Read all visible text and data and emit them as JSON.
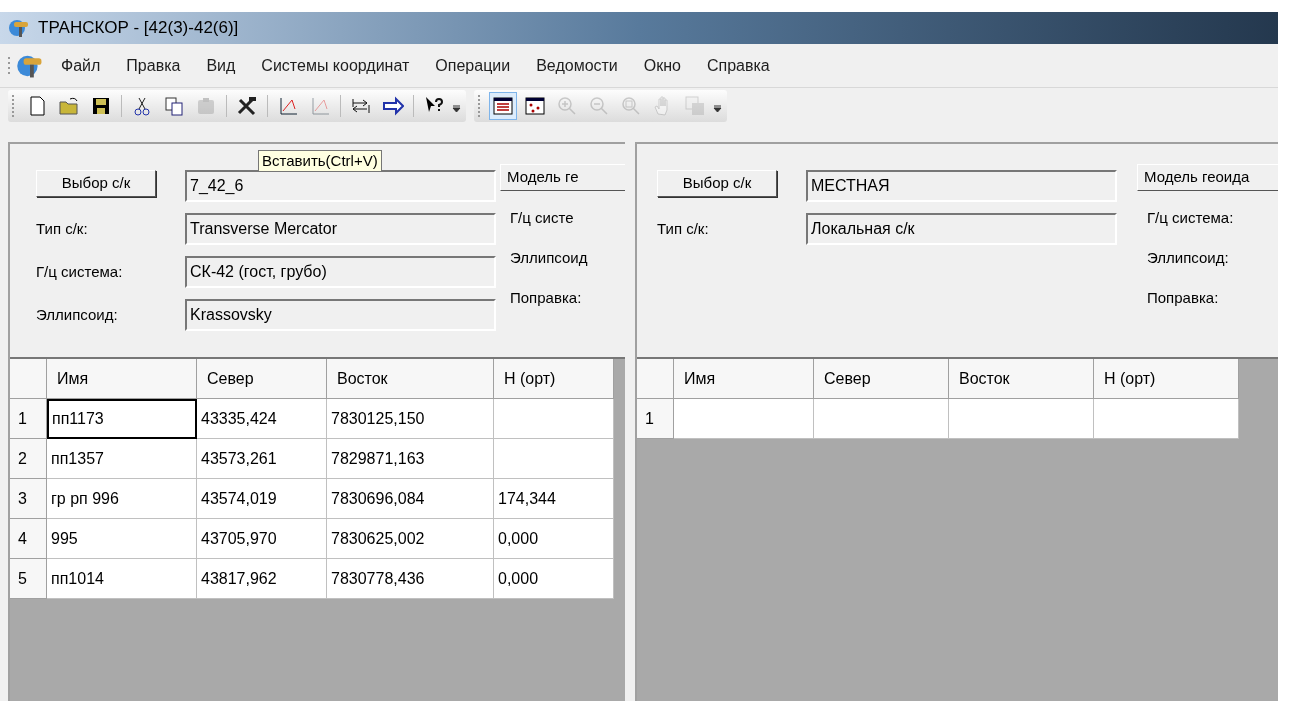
{
  "window": {
    "title": "ТРАНСКОР - [42(3)-42(6)]"
  },
  "menu": [
    "Файл",
    "Правка",
    "Вид",
    "Системы координат",
    "Операции",
    "Ведомости",
    "Окно",
    "Справка"
  ],
  "toolbars": [
    [
      {
        "kind": "new",
        "disabled": false,
        "selected": false,
        "group_end": false
      },
      {
        "kind": "open",
        "disabled": false,
        "selected": false,
        "group_end": false
      },
      {
        "kind": "save",
        "disabled": false,
        "selected": false,
        "group_end": true
      },
      {
        "kind": "cut",
        "disabled": false,
        "selected": false,
        "group_end": false
      },
      {
        "kind": "copy",
        "disabled": false,
        "selected": false,
        "group_end": false
      },
      {
        "kind": "paste",
        "disabled": true,
        "selected": false,
        "group_end": true
      },
      {
        "kind": "tools",
        "disabled": false,
        "selected": false,
        "group_end": true
      },
      {
        "kind": "axes",
        "disabled": false,
        "selected": false,
        "group_end": false
      },
      {
        "kind": "axes",
        "disabled": true,
        "selected": false,
        "group_end": true
      },
      {
        "kind": "swap",
        "disabled": false,
        "selected": false,
        "group_end": false
      },
      {
        "kind": "arrow",
        "disabled": false,
        "selected": false,
        "group_end": true
      },
      {
        "kind": "help",
        "disabled": false,
        "selected": false,
        "group_end": false
      }
    ],
    [
      {
        "kind": "list",
        "disabled": false,
        "selected": true,
        "group_end": false
      },
      {
        "kind": "map",
        "disabled": false,
        "selected": false,
        "group_end": false
      },
      {
        "kind": "zoomin",
        "disabled": true,
        "selected": false,
        "group_end": false
      },
      {
        "kind": "zoomout",
        "disabled": true,
        "selected": false,
        "group_end": false
      },
      {
        "kind": "zoomfit",
        "disabled": true,
        "selected": false,
        "group_end": false
      },
      {
        "kind": "hand",
        "disabled": true,
        "selected": false,
        "group_end": false
      },
      {
        "kind": "layer",
        "disabled": true,
        "selected": false,
        "group_end": false
      }
    ]
  ],
  "tooltip": "Вставить(Ctrl+V)",
  "panels": [
    {
      "select_button": "Выбор с/к",
      "name_value": "7_42_6",
      "model_button": "Модель ге",
      "fields": [
        {
          "label": "Тип с/к:",
          "value": "Transverse Mercator"
        },
        {
          "label": "Г/ц система:",
          "value": "СК-42 (гост, грубо)"
        },
        {
          "label": "Эллипсоид:",
          "value": "Krassovsky"
        }
      ],
      "side_labels": [
        "Г/ц систе",
        "Эллипсоид",
        "Поправка:"
      ],
      "table": {
        "columns": [
          "Имя",
          "Север",
          "Восток",
          "H (орт)"
        ],
        "rows": [
          {
            "number": "1",
            "selected": true,
            "cells": [
              "пп1173",
              "43335,424",
              "7830125,150",
              ""
            ]
          },
          {
            "number": "2",
            "selected": false,
            "cells": [
              "пп1357",
              "43573,261",
              "7829871,163",
              ""
            ]
          },
          {
            "number": "3",
            "selected": false,
            "cells": [
              "гр рп 996",
              "43574,019",
              "7830696,084",
              "174,344"
            ]
          },
          {
            "number": "4",
            "selected": false,
            "cells": [
              "995",
              "43705,970",
              "7830625,002",
              "0,000"
            ]
          },
          {
            "number": "5",
            "selected": false,
            "cells": [
              "пп1014",
              "43817,962",
              "7830778,436",
              "0,000"
            ]
          }
        ]
      }
    },
    {
      "select_button": "Выбор с/к",
      "name_value": "МЕСТНАЯ",
      "model_button": "Модель геоида",
      "fields": [
        {
          "label": "Тип с/к:",
          "value": "Локальная с/к"
        }
      ],
      "side_labels": [
        "Г/ц система:",
        "Эллипсоид:",
        "Поправка:"
      ],
      "table": {
        "columns": [
          "Имя",
          "Север",
          "Восток",
          "H (орт)"
        ],
        "rows": [
          {
            "number": "1",
            "selected": false,
            "cells": [
              "",
              "",
              "",
              ""
            ]
          }
        ]
      }
    }
  ]
}
